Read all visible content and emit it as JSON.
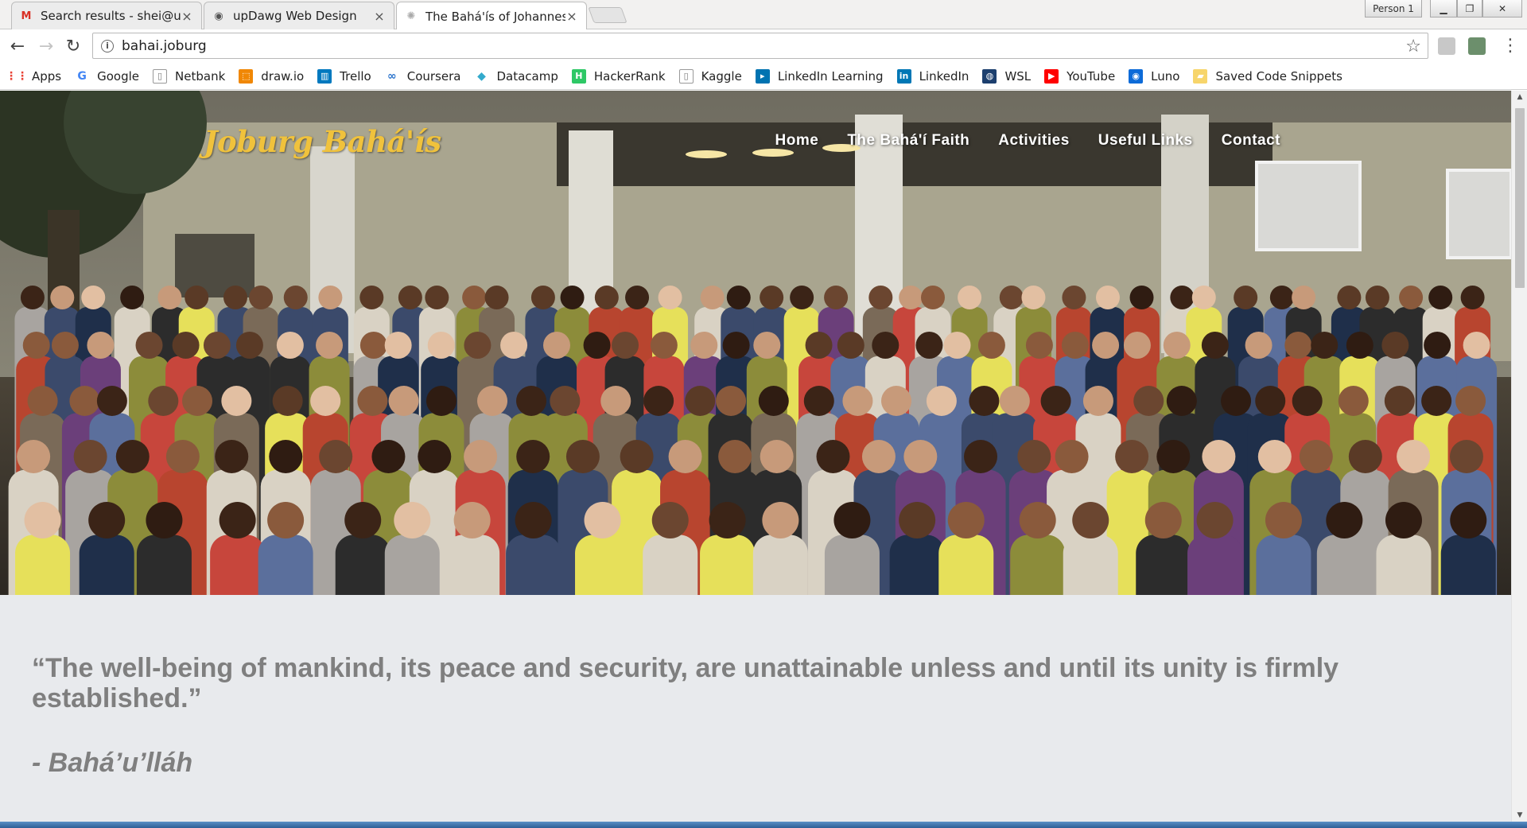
{
  "browser": {
    "tabs": [
      {
        "title": "Search results - shei@up",
        "favicon": "gmail-icon",
        "active": false
      },
      {
        "title": "upDawg Web Design",
        "favicon": "dog-icon",
        "active": false
      },
      {
        "title": "The Bahá'ís of Johannes",
        "favicon": "loading-icon",
        "active": true
      }
    ],
    "profile_label": "Person 1",
    "url": "bahai.joburg",
    "bookmarks": [
      {
        "label": "Apps",
        "icon": "apps-grid-icon",
        "color": "#e94235"
      },
      {
        "label": "Google",
        "icon": "google-icon",
        "color": "#4285f4"
      },
      {
        "label": "Netbank",
        "icon": "page-icon",
        "color": "#ffffff"
      },
      {
        "label": "draw.io",
        "icon": "drawio-icon",
        "color": "#f08705"
      },
      {
        "label": "Trello",
        "icon": "trello-icon",
        "color": "#0079bf"
      },
      {
        "label": "Coursera",
        "icon": "coursera-icon",
        "color": "#2a73cc"
      },
      {
        "label": "Datacamp",
        "icon": "datacamp-icon",
        "color": "#33aacc"
      },
      {
        "label": "HackerRank",
        "icon": "hackerrank-icon",
        "color": "#2ec866"
      },
      {
        "label": "Kaggle",
        "icon": "page-icon",
        "color": "#ffffff"
      },
      {
        "label": "LinkedIn Learning",
        "icon": "linkedin-learning-icon",
        "color": "#0073b1"
      },
      {
        "label": "LinkedIn",
        "icon": "linkedin-icon",
        "color": "#0077b5"
      },
      {
        "label": "WSL",
        "icon": "wsl-icon",
        "color": "#1c3f6e"
      },
      {
        "label": "YouTube",
        "icon": "youtube-icon",
        "color": "#ff0000"
      },
      {
        "label": "Luno",
        "icon": "luno-icon",
        "color": "#0d6bd8"
      },
      {
        "label": "Saved Code Snippets",
        "icon": "folder-icon",
        "color": "#f7d56b"
      }
    ]
  },
  "site": {
    "logo": "Joburg Bahá'ís",
    "nav": [
      "Home",
      "The Bahá'í Faith",
      "Activities",
      "Useful Links",
      "Contact"
    ],
    "quote": "“The well-being of mankind, its peace and security, are unattainable unless and until its unity is firmly established.”",
    "attribution": "- Bahá’u’lláh"
  },
  "colors": {
    "logo": "#f0c23c",
    "quote_text": "#7f7f7f",
    "quote_bg": "#e8eaed"
  }
}
